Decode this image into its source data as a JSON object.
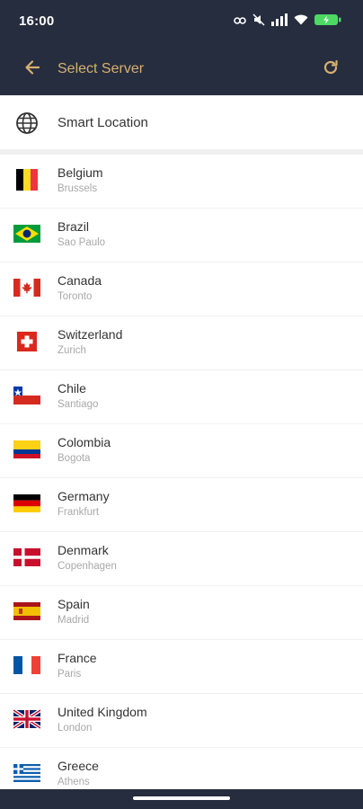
{
  "status_bar": {
    "time": "16:00",
    "icons": [
      "link-icon",
      "mute-icon",
      "signal-icon",
      "wifi-icon",
      "battery-charging-icon"
    ]
  },
  "app_bar": {
    "title": "Select Server",
    "back_icon": "arrow-left-icon",
    "refresh_icon": "refresh-icon"
  },
  "smart_location": {
    "label": "Smart Location",
    "icon": "globe-icon"
  },
  "servers": [
    {
      "country": "Belgium",
      "city": "Brussels",
      "flag": "be"
    },
    {
      "country": "Brazil",
      "city": "Sao Paulo",
      "flag": "br"
    },
    {
      "country": "Canada",
      "city": "Toronto",
      "flag": "ca"
    },
    {
      "country": "Switzerland",
      "city": "Zurich",
      "flag": "ch"
    },
    {
      "country": "Chile",
      "city": "Santiago",
      "flag": "cl"
    },
    {
      "country": "Colombia",
      "city": "Bogota",
      "flag": "co"
    },
    {
      "country": "Germany",
      "city": "Frankfurt",
      "flag": "de"
    },
    {
      "country": "Denmark",
      "city": "Copenhagen",
      "flag": "dk"
    },
    {
      "country": "Spain",
      "city": "Madrid",
      "flag": "es"
    },
    {
      "country": "France",
      "city": "Paris",
      "flag": "fr"
    },
    {
      "country": "United Kingdom",
      "city": "London",
      "flag": "gb"
    },
    {
      "country": "Greece",
      "city": "Athens",
      "flag": "gr"
    }
  ],
  "colors": {
    "header_bg": "#262d3f",
    "accent": "#d7b06f",
    "battery": "#4cd964"
  }
}
